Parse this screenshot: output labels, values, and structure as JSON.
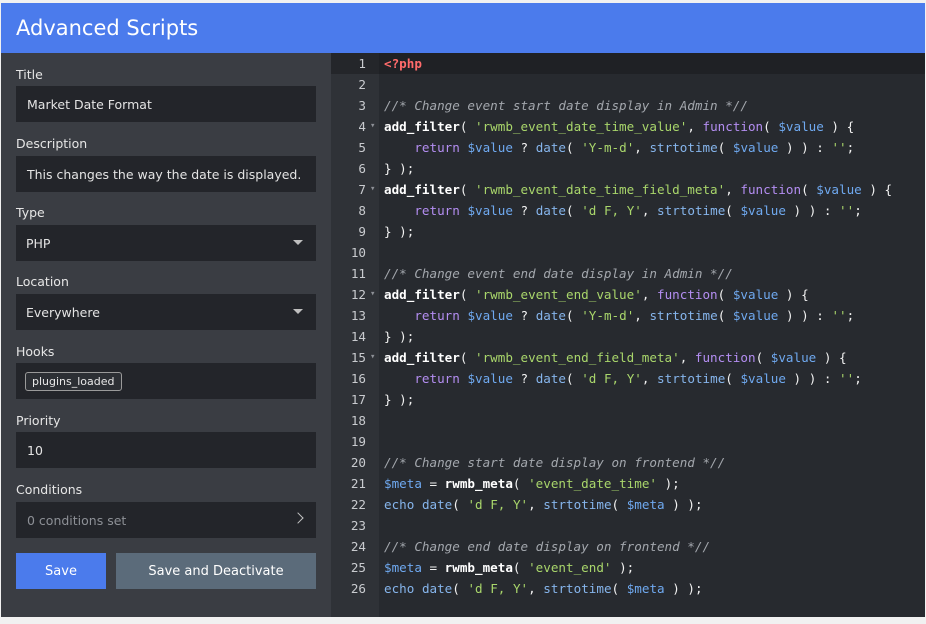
{
  "header": {
    "title": "Advanced Scripts"
  },
  "form": {
    "title_label": "Title",
    "title_value": "Market Date Format",
    "description_label": "Description",
    "description_value": "This changes the way the date is displayed.",
    "type_label": "Type",
    "type_value": "PHP",
    "location_label": "Location",
    "location_value": "Everywhere",
    "hooks_label": "Hooks",
    "hooks_tag": "plugins_loaded",
    "priority_label": "Priority",
    "priority_value": "10",
    "conditions_label": "Conditions",
    "conditions_value": "0 conditions set",
    "save_label": "Save",
    "save_deactivate_label": "Save and Deactivate"
  },
  "icons": {
    "type_caret": "chevron-down-icon",
    "location_caret": "chevron-down-icon",
    "conditions_arrow": "chevron-right-icon"
  },
  "colors": {
    "accent": "#4b7bec",
    "sidebar_bg": "#3a3d43",
    "editor_bg": "#272a2f",
    "secondary_button": "#5b6b7a"
  },
  "editor": {
    "active_line": 1,
    "lines": [
      {
        "n": "1",
        "fold": false,
        "tokens": [
          [
            "php",
            "<?php"
          ]
        ]
      },
      {
        "n": "2",
        "fold": false,
        "tokens": []
      },
      {
        "n": "3",
        "fold": false,
        "tokens": [
          [
            "com",
            "//* Change event start date display in Admin *//"
          ]
        ]
      },
      {
        "n": "4",
        "fold": true,
        "tokens": [
          [
            "fn",
            "add_filter"
          ],
          [
            "pl",
            "( "
          ],
          [
            "str",
            "'rwmb_event_date_time_value'"
          ],
          [
            "pl",
            ", "
          ],
          [
            "kw",
            "function"
          ],
          [
            "pl",
            "( "
          ],
          [
            "var",
            "$value"
          ],
          [
            "pl",
            " ) {"
          ]
        ]
      },
      {
        "n": "5",
        "fold": false,
        "tokens": [
          [
            "pl",
            "    "
          ],
          [
            "kw",
            "return"
          ],
          [
            "pl",
            " "
          ],
          [
            "var",
            "$value"
          ],
          [
            "pl",
            " ? "
          ],
          [
            "blt",
            "date"
          ],
          [
            "pl",
            "( "
          ],
          [
            "str",
            "'Y-m-d'"
          ],
          [
            "pl",
            ", "
          ],
          [
            "blt",
            "strtotime"
          ],
          [
            "pl",
            "( "
          ],
          [
            "var",
            "$value"
          ],
          [
            "pl",
            " ) ) : "
          ],
          [
            "str",
            "''"
          ],
          [
            "pl",
            ";"
          ]
        ]
      },
      {
        "n": "6",
        "fold": false,
        "tokens": [
          [
            "pl",
            "} );"
          ]
        ]
      },
      {
        "n": "7",
        "fold": true,
        "tokens": [
          [
            "fn",
            "add_filter"
          ],
          [
            "pl",
            "( "
          ],
          [
            "str",
            "'rwmb_event_date_time_field_meta'"
          ],
          [
            "pl",
            ", "
          ],
          [
            "kw",
            "function"
          ],
          [
            "pl",
            "( "
          ],
          [
            "var",
            "$value"
          ],
          [
            "pl",
            " ) {"
          ]
        ]
      },
      {
        "n": "8",
        "fold": false,
        "tokens": [
          [
            "pl",
            "    "
          ],
          [
            "kw",
            "return"
          ],
          [
            "pl",
            " "
          ],
          [
            "var",
            "$value"
          ],
          [
            "pl",
            " ? "
          ],
          [
            "blt",
            "date"
          ],
          [
            "pl",
            "( "
          ],
          [
            "str",
            "'d F, Y'"
          ],
          [
            "pl",
            ", "
          ],
          [
            "blt",
            "strtotime"
          ],
          [
            "pl",
            "( "
          ],
          [
            "var",
            "$value"
          ],
          [
            "pl",
            " ) ) : "
          ],
          [
            "str",
            "''"
          ],
          [
            "pl",
            ";"
          ]
        ]
      },
      {
        "n": "9",
        "fold": false,
        "tokens": [
          [
            "pl",
            "} );"
          ]
        ]
      },
      {
        "n": "10",
        "fold": false,
        "tokens": []
      },
      {
        "n": "11",
        "fold": false,
        "tokens": [
          [
            "com",
            "//* Change event end date display in Admin *//"
          ]
        ]
      },
      {
        "n": "12",
        "fold": true,
        "tokens": [
          [
            "fn",
            "add_filter"
          ],
          [
            "pl",
            "( "
          ],
          [
            "str",
            "'rwmb_event_end_value'"
          ],
          [
            "pl",
            ", "
          ],
          [
            "kw",
            "function"
          ],
          [
            "pl",
            "( "
          ],
          [
            "var",
            "$value"
          ],
          [
            "pl",
            " ) {"
          ]
        ]
      },
      {
        "n": "13",
        "fold": false,
        "tokens": [
          [
            "pl",
            "    "
          ],
          [
            "kw",
            "return"
          ],
          [
            "pl",
            " "
          ],
          [
            "var",
            "$value"
          ],
          [
            "pl",
            " ? "
          ],
          [
            "blt",
            "date"
          ],
          [
            "pl",
            "( "
          ],
          [
            "str",
            "'Y-m-d'"
          ],
          [
            "pl",
            ", "
          ],
          [
            "blt",
            "strtotime"
          ],
          [
            "pl",
            "( "
          ],
          [
            "var",
            "$value"
          ],
          [
            "pl",
            " ) ) : "
          ],
          [
            "str",
            "''"
          ],
          [
            "pl",
            ";"
          ]
        ]
      },
      {
        "n": "14",
        "fold": false,
        "tokens": [
          [
            "pl",
            "} );"
          ]
        ]
      },
      {
        "n": "15",
        "fold": true,
        "tokens": [
          [
            "fn",
            "add_filter"
          ],
          [
            "pl",
            "( "
          ],
          [
            "str",
            "'rwmb_event_end_field_meta'"
          ],
          [
            "pl",
            ", "
          ],
          [
            "kw",
            "function"
          ],
          [
            "pl",
            "( "
          ],
          [
            "var",
            "$value"
          ],
          [
            "pl",
            " ) {"
          ]
        ]
      },
      {
        "n": "16",
        "fold": false,
        "tokens": [
          [
            "pl",
            "    "
          ],
          [
            "kw",
            "return"
          ],
          [
            "pl",
            " "
          ],
          [
            "var",
            "$value"
          ],
          [
            "pl",
            " ? "
          ],
          [
            "blt",
            "date"
          ],
          [
            "pl",
            "( "
          ],
          [
            "str",
            "'d F, Y'"
          ],
          [
            "pl",
            ", "
          ],
          [
            "blt",
            "strtotime"
          ],
          [
            "pl",
            "( "
          ],
          [
            "var",
            "$value"
          ],
          [
            "pl",
            " ) ) : "
          ],
          [
            "str",
            "''"
          ],
          [
            "pl",
            ";"
          ]
        ]
      },
      {
        "n": "17",
        "fold": false,
        "tokens": [
          [
            "pl",
            "} );"
          ]
        ]
      },
      {
        "n": "18",
        "fold": false,
        "tokens": []
      },
      {
        "n": "19",
        "fold": false,
        "tokens": []
      },
      {
        "n": "20",
        "fold": false,
        "tokens": [
          [
            "com",
            "//* Change start date display on frontend *//"
          ]
        ]
      },
      {
        "n": "21",
        "fold": false,
        "tokens": [
          [
            "var",
            "$meta"
          ],
          [
            "pl",
            " = "
          ],
          [
            "fn",
            "rwmb_meta"
          ],
          [
            "pl",
            "( "
          ],
          [
            "str",
            "'event_date_time'"
          ],
          [
            "pl",
            " );"
          ]
        ]
      },
      {
        "n": "22",
        "fold": false,
        "tokens": [
          [
            "blt",
            "echo"
          ],
          [
            "pl",
            " "
          ],
          [
            "blt",
            "date"
          ],
          [
            "pl",
            "( "
          ],
          [
            "str",
            "'d F, Y'"
          ],
          [
            "pl",
            ", "
          ],
          [
            "blt",
            "strtotime"
          ],
          [
            "pl",
            "( "
          ],
          [
            "var",
            "$meta"
          ],
          [
            "pl",
            " ) );"
          ]
        ]
      },
      {
        "n": "23",
        "fold": false,
        "tokens": []
      },
      {
        "n": "24",
        "fold": false,
        "tokens": [
          [
            "com",
            "//* Change end date display on frontend *//"
          ]
        ]
      },
      {
        "n": "25",
        "fold": false,
        "tokens": [
          [
            "var",
            "$meta"
          ],
          [
            "pl",
            " = "
          ],
          [
            "fn",
            "rwmb_meta"
          ],
          [
            "pl",
            "( "
          ],
          [
            "str",
            "'event_end'"
          ],
          [
            "pl",
            " );"
          ]
        ]
      },
      {
        "n": "26",
        "fold": false,
        "tokens": [
          [
            "blt",
            "echo"
          ],
          [
            "pl",
            " "
          ],
          [
            "blt",
            "date"
          ],
          [
            "pl",
            "( "
          ],
          [
            "str",
            "'d F, Y'"
          ],
          [
            "pl",
            ", "
          ],
          [
            "blt",
            "strtotime"
          ],
          [
            "pl",
            "( "
          ],
          [
            "var",
            "$meta"
          ],
          [
            "pl",
            " ) );"
          ]
        ]
      }
    ]
  }
}
